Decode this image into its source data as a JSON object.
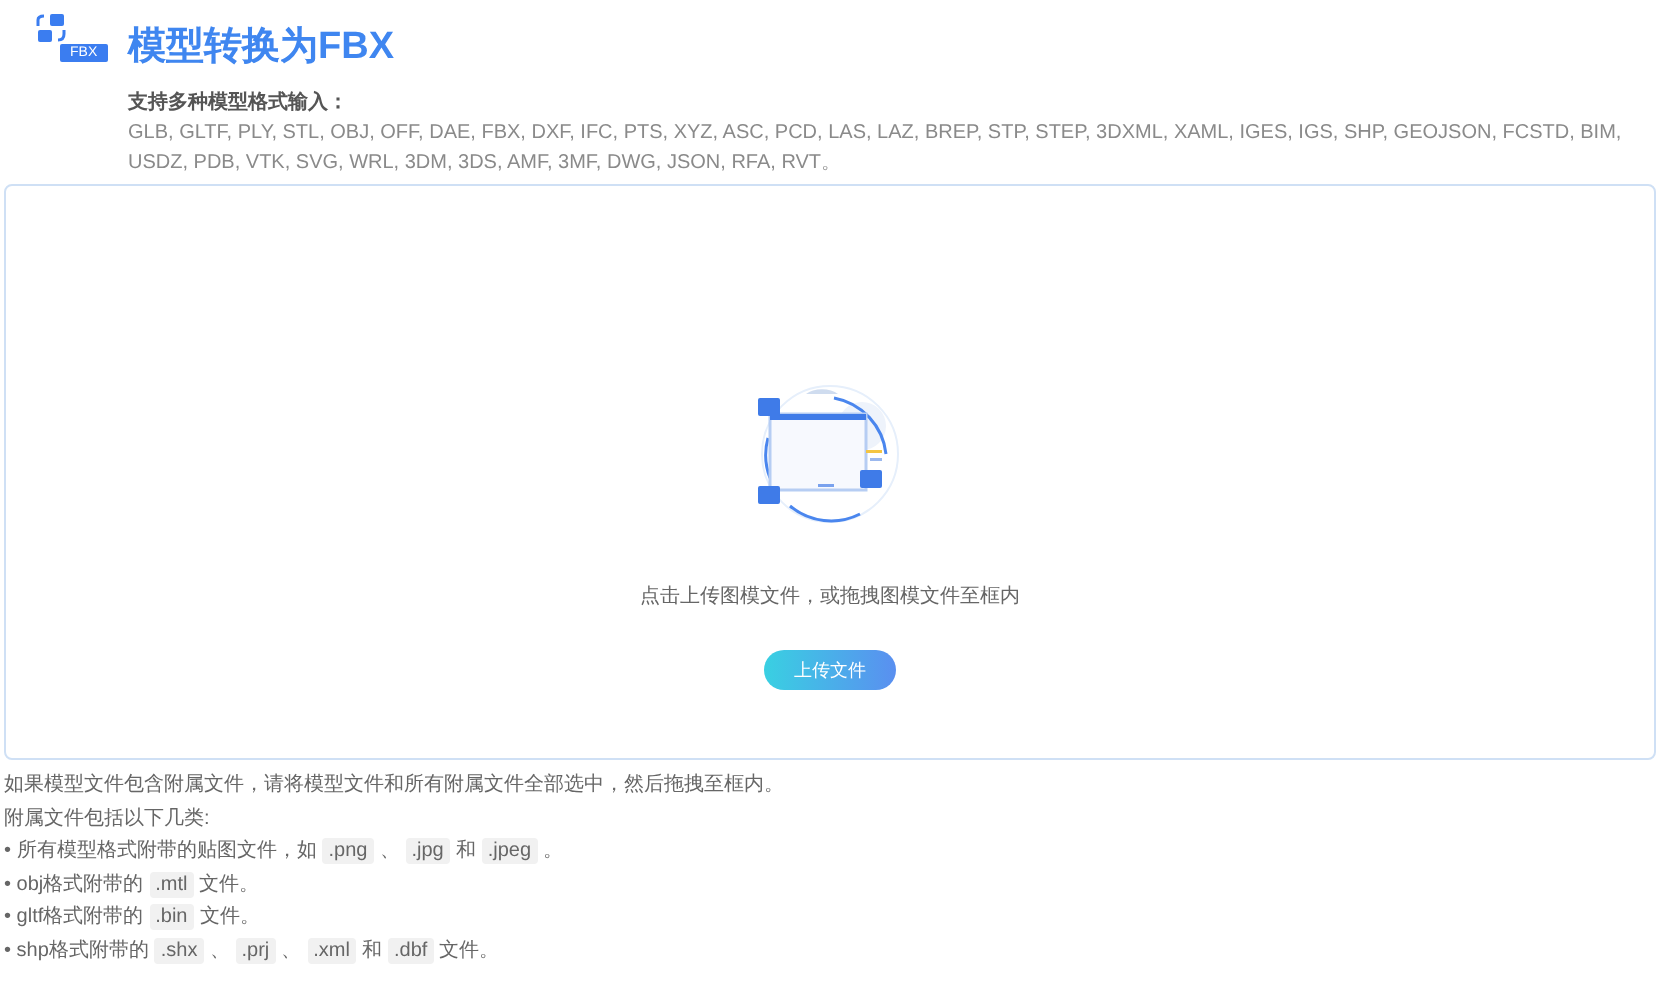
{
  "header": {
    "badge": "FBX",
    "title": "模型转换为FBX",
    "subtitle": "支持多种模型格式输入：",
    "formats": "GLB, GLTF, PLY, STL, OBJ, OFF, DAE, FBX, DXF, IFC, PTS, XYZ, ASC, PCD, LAS, LAZ, BREP, STP, STEP, 3DXML, XAML, IGES, IGS, SHP, GEOJSON, FCSTD, BIM, USDZ, PDB, VTK, SVG, WRL, 3DM, 3DS, AMF, 3MF, DWG, JSON, RFA, RVT。"
  },
  "dropzone": {
    "hint": "点击上传图模文件，或拖拽图模文件至框内",
    "button": "上传文件"
  },
  "notes": {
    "intro": "如果模型文件包含附属文件，请将模型文件和所有附属文件全部选中，然后拖拽至框内。",
    "list_title": "附属文件包括以下几类:",
    "items": [
      [
        {
          "text": "• 所有模型格式附带的贴图文件，如",
          "code": false
        },
        {
          "text": ".png",
          "code": true
        },
        {
          "text": "、",
          "code": false
        },
        {
          "text": ".jpg",
          "code": true
        },
        {
          "text": "和",
          "code": false
        },
        {
          "text": ".jpeg",
          "code": true
        },
        {
          "text": "。",
          "code": false
        }
      ],
      [
        {
          "text": "• obj格式附带的",
          "code": false
        },
        {
          "text": ".mtl",
          "code": true
        },
        {
          "text": "文件。",
          "code": false
        }
      ],
      [
        {
          "text": "• gltf格式附带的",
          "code": false
        },
        {
          "text": ".bin",
          "code": true
        },
        {
          "text": "文件。",
          "code": false
        }
      ],
      [
        {
          "text": "• shp格式附带的",
          "code": false
        },
        {
          "text": ".shx",
          "code": true
        },
        {
          "text": "、",
          "code": false
        },
        {
          "text": ".prj",
          "code": true
        },
        {
          "text": "、",
          "code": false
        },
        {
          "text": ".xml",
          "code": true
        },
        {
          "text": "和",
          "code": false
        },
        {
          "text": ".dbf",
          "code": true
        },
        {
          "text": "文件。",
          "code": false
        }
      ]
    ]
  }
}
